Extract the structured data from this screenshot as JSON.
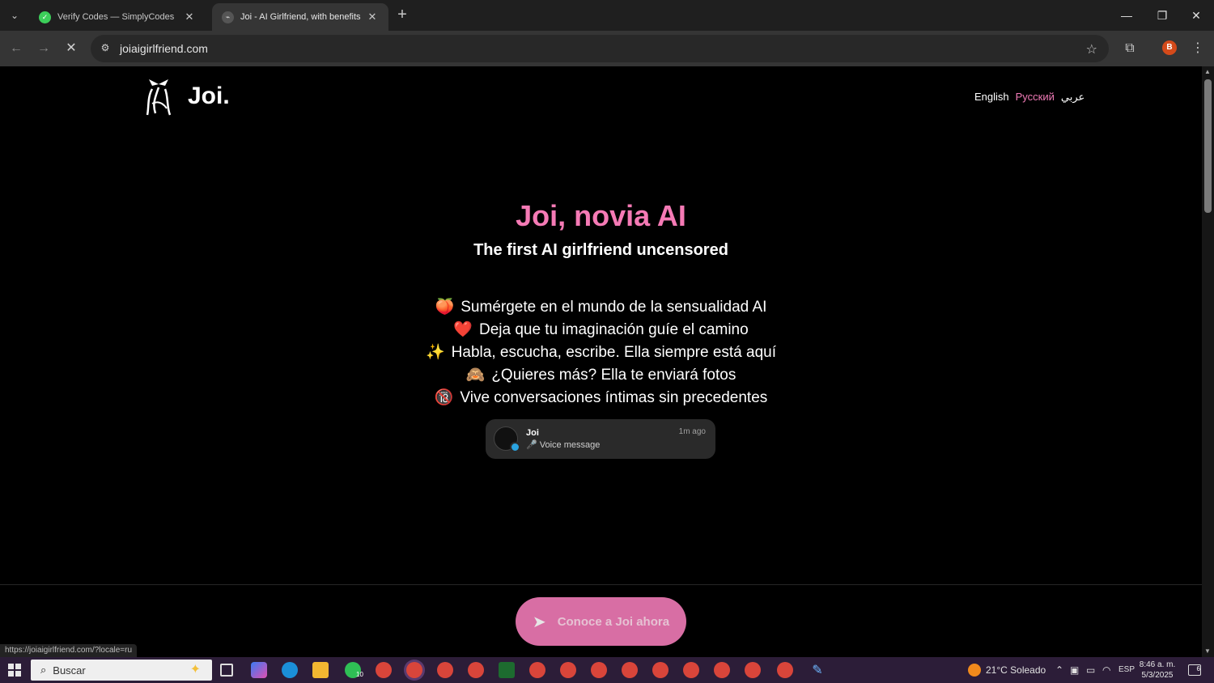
{
  "browser": {
    "tabs": [
      {
        "title": "Verify Codes — SimplyCodes",
        "active": false,
        "favicon_color": "#3ccf5a"
      },
      {
        "title": "Joi - AI Girlfriend, with benefits",
        "active": true,
        "favicon_color": "#6d6d6d"
      }
    ],
    "url": "joiaigirlfriend.com",
    "profile_initial": "B",
    "status_url": "https://joiaigirlfriend.com/?locale=ru"
  },
  "site": {
    "brand": "Joi.",
    "languages": {
      "english": "English",
      "russian": "Русский",
      "arabic": "عربي"
    },
    "hero_title": "Joi, novia AI",
    "hero_subtitle": "The first AI girlfriend uncensored",
    "features": [
      {
        "emoji": "🍑",
        "text": "Sumérgete en el mundo de la sensualidad AI"
      },
      {
        "emoji": "❤️",
        "text": "Deja que tu imaginación guíe el camino"
      },
      {
        "emoji": "✨",
        "text": "Habla, escucha, escribe. Ella siempre está aquí"
      },
      {
        "emoji": "🙈",
        "text": "¿Quieres más? Ella te enviará fotos"
      },
      {
        "emoji": "🔞",
        "text": "Vive conversaciones íntimas sin precedentes"
      }
    ],
    "notification": {
      "name": "Joi",
      "message": "🎤 Voice message",
      "time": "1m ago"
    },
    "cta_label": "Conoce a Joi ahora",
    "accent_color": "#f57ab5"
  },
  "taskbar": {
    "search_placeholder": "Buscar",
    "weather": "21°C Soleado",
    "language": "ESP",
    "time": "8:46 a. m.",
    "date": "5/3/2025",
    "whatsapp_badge": "10",
    "notification_count": "6"
  }
}
